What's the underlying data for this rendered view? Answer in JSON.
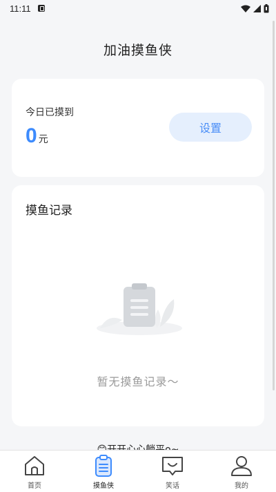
{
  "status_bar": {
    "time": "11:11"
  },
  "header": {
    "title": "加油摸鱼侠"
  },
  "today_card": {
    "label": "今日已摸到",
    "amount": "0",
    "unit": "元",
    "settings_label": "设置"
  },
  "records_card": {
    "title": "摸鱼记录",
    "empty_text": "暂无摸鱼记录～"
  },
  "slogan": "😊开开心心躺平o~",
  "tabs": [
    {
      "label": "首页",
      "icon": "home-icon",
      "active": false
    },
    {
      "label": "摸鱼侠",
      "icon": "clipboard-icon",
      "active": true
    },
    {
      "label": "笑话",
      "icon": "chat-smile-icon",
      "active": false
    },
    {
      "label": "我的",
      "icon": "user-icon",
      "active": false
    }
  ],
  "colors": {
    "accent": "#3d8bfd",
    "button_bg": "#e5effd",
    "page_bg": "#f5f6f8"
  }
}
